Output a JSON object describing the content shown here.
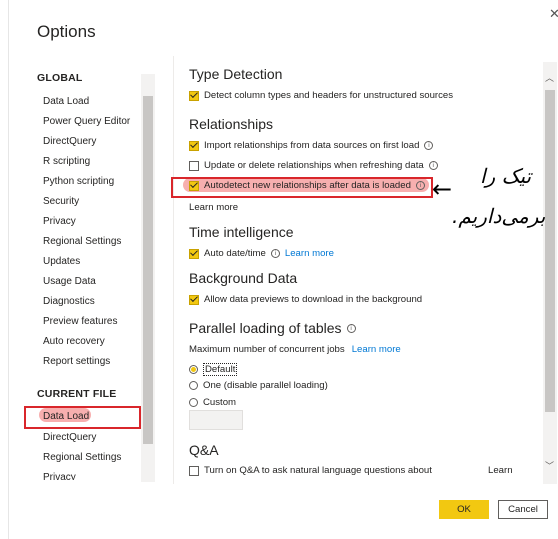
{
  "window": {
    "title": "Options",
    "close_glyph": "✕"
  },
  "left_nav": {
    "global_header": "GLOBAL",
    "global_items": [
      "Data Load",
      "Power Query Editor",
      "DirectQuery",
      "R scripting",
      "Python scripting",
      "Security",
      "Privacy",
      "Regional Settings",
      "Updates",
      "Usage Data",
      "Diagnostics",
      "Preview features",
      "Auto recovery",
      "Report settings"
    ],
    "current_header": "CURRENT FILE",
    "current_items": [
      "Data Load",
      "DirectQuery",
      "Regional Settings",
      "Privacy"
    ],
    "selected_item": "Data Load"
  },
  "sections": {
    "type_detection": {
      "title": "Type Detection",
      "detect_label": "Detect column types and headers for unstructured sources",
      "detect_checked": true
    },
    "relationships": {
      "title": "Relationships",
      "import_label": "Import relationships from data sources on first load",
      "import_checked": true,
      "update_label": "Update or delete relationships when refreshing data",
      "update_checked": false,
      "autodetect_label": "Autodetect new relationships after data is loaded",
      "autodetect_checked": true,
      "learn_more": "Learn more"
    },
    "time_intelligence": {
      "title": "Time intelligence",
      "auto_date_label": "Auto date/time",
      "auto_date_checked": true,
      "learn_more": "Learn more"
    },
    "background_data": {
      "title": "Background Data",
      "previews_label": "Allow data previews to download in the background",
      "previews_checked": true
    },
    "parallel_loading": {
      "title": "Parallel loading of tables",
      "max_label": "Maximum number of concurrent jobs",
      "learn_more": "Learn more",
      "options": [
        "Default",
        "One (disable parallel loading)",
        "Custom"
      ],
      "selected": "Default"
    },
    "qa": {
      "title": "Q&A",
      "turn_on_label": "Turn on Q&A to ask natural language questions about",
      "turn_on_checked": false,
      "learn_more": "Learn"
    }
  },
  "buttons": {
    "ok": "OK",
    "cancel": "Cancel"
  },
  "annotation": {
    "arrow": "←",
    "line1": "تیک را",
    "line2": "برمی‌داریم."
  },
  "colors": {
    "accent": "#f2c811",
    "link": "#0078d4",
    "annotation_red": "#d9262b"
  }
}
